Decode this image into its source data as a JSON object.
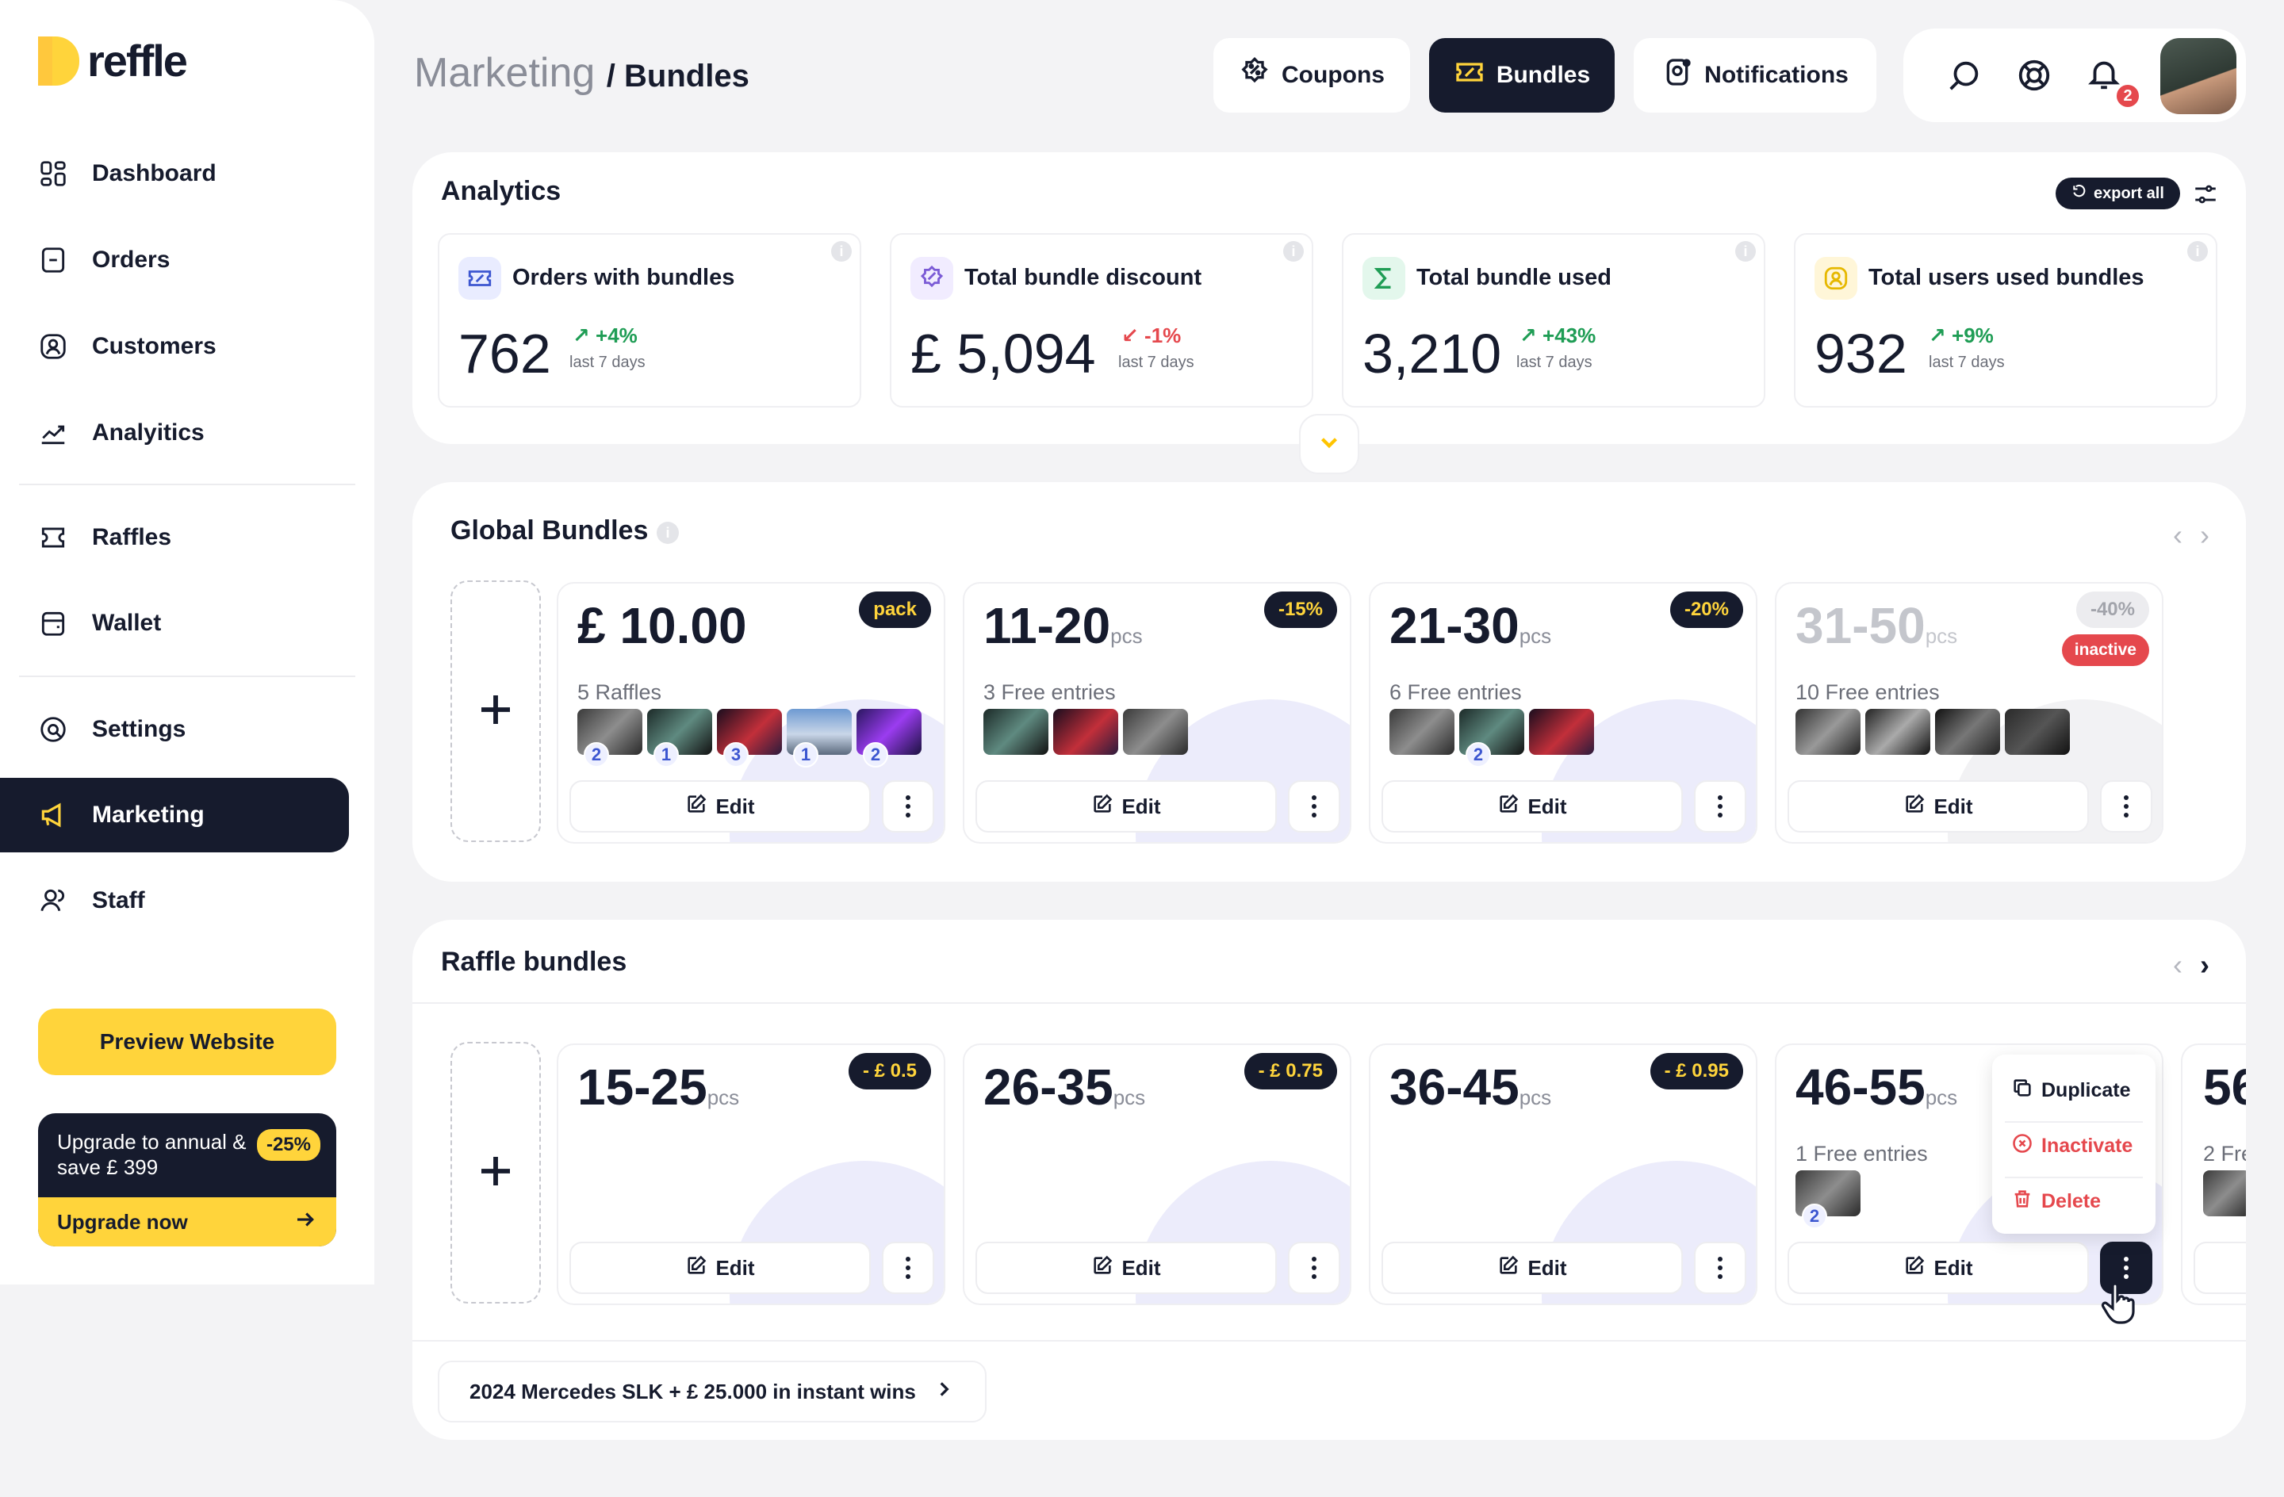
{
  "sidebar": {
    "logo_text": "reffle",
    "items": [
      {
        "label": "Dashboard",
        "icon": "dashboard-icon"
      },
      {
        "label": "Orders",
        "icon": "orders-icon"
      },
      {
        "label": "Customers",
        "icon": "customers-icon"
      },
      {
        "label": "Analyitics",
        "icon": "analytics-icon"
      },
      {
        "label": "Raffles",
        "icon": "ticket-icon"
      },
      {
        "label": "Wallet",
        "icon": "wallet-icon"
      },
      {
        "label": "Settings",
        "icon": "settings-icon"
      },
      {
        "label": "Marketing",
        "icon": "megaphone-icon",
        "active": true
      },
      {
        "label": "Staff",
        "icon": "staff-icon"
      }
    ],
    "preview_label": "Preview Website",
    "upgrade": {
      "text": "Upgrade to annual & save £ 399",
      "badge": "-25%",
      "cta": "Upgrade now"
    }
  },
  "header": {
    "section": "Marketing",
    "separator": "/",
    "page": "Bundles",
    "tabs": [
      {
        "label": "Coupons",
        "icon": "coupon-icon"
      },
      {
        "label": "Bundles",
        "icon": "bundle-icon",
        "active": true
      },
      {
        "label": "Notifications",
        "icon": "notification-app-icon"
      }
    ],
    "notification_count": "2"
  },
  "analytics": {
    "title": "Analytics",
    "export_label": "export all",
    "stats": [
      {
        "label": "Orders with bundles",
        "value": "762",
        "delta": "+4%",
        "trend": "up",
        "period": "last 7 days"
      },
      {
        "label": "Total bundle discount",
        "value": "£ 5,094",
        "delta": "-1%",
        "trend": "down",
        "period": "last 7 days"
      },
      {
        "label": "Total bundle used",
        "value": "3,210",
        "delta": "+43%",
        "trend": "up",
        "period": "last 7 days"
      },
      {
        "label": "Total users used bundles",
        "value": "932",
        "delta": "+9%",
        "trend": "up",
        "period": "last 7 days"
      }
    ]
  },
  "global_bundles": {
    "title": "Global Bundles",
    "cards": [
      {
        "title": "£ 10.00",
        "unit": "",
        "badge": "pack",
        "sub": "5 Raffles",
        "counts": [
          "2",
          "1",
          "3",
          "1",
          "2"
        ],
        "edit": "Edit"
      },
      {
        "title": "11-20",
        "unit": "pcs",
        "badge": "-15%",
        "sub": "3 Free entries",
        "counts": [
          "",
          "",
          ""
        ],
        "edit": "Edit"
      },
      {
        "title": "21-30",
        "unit": "pcs",
        "badge": "-20%",
        "sub": "6 Free entries",
        "counts": [
          "",
          "2",
          ""
        ],
        "edit": "Edit"
      },
      {
        "title": "31-50",
        "unit": "pcs",
        "badge": "-40%",
        "status": "inactive",
        "sub": "10 Free entries",
        "counts": [
          "",
          "",
          "",
          ""
        ],
        "edit": "Edit"
      }
    ]
  },
  "raffle_bundles": {
    "title": "Raffle bundles",
    "cards": [
      {
        "title": "15-25",
        "unit": "pcs",
        "badge": "- £ 0.5",
        "edit": "Edit"
      },
      {
        "title": "26-35",
        "unit": "pcs",
        "badge": "- £ 0.75",
        "edit": "Edit"
      },
      {
        "title": "36-45",
        "unit": "pcs",
        "badge": "- £ 0.95",
        "edit": "Edit"
      },
      {
        "title": "46-55",
        "unit": "pcs",
        "sub": "1 Free entries",
        "count": "2",
        "edit": "Edit"
      },
      {
        "title": "56",
        "sub": "2 Fre"
      }
    ],
    "menu": {
      "duplicate": "Duplicate",
      "inactivate": "Inactivate",
      "delete": "Delete"
    },
    "footer_link": "2024 Mercedes SLK + £ 25.000 in instant wins"
  },
  "colors": {
    "accent": "#ffd43b",
    "dark": "#161b2d",
    "positive": "#1f9d55",
    "negative": "#e5484d"
  }
}
